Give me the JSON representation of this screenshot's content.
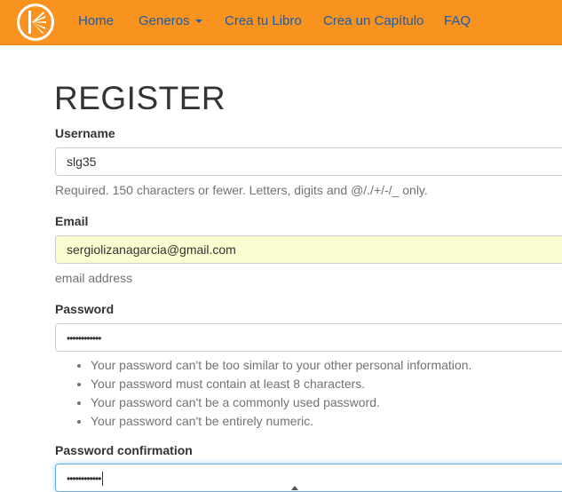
{
  "navbar": {
    "logo_icon": "book-logo-icon",
    "links": {
      "home": "Home",
      "generos": "Generos",
      "crea_libro": "Crea tu Libro",
      "crea_capitulo": "Crea un Capítulo",
      "faq": "FAQ"
    },
    "colors": {
      "background": "#f7931e",
      "link": "#1a5dab"
    }
  },
  "form": {
    "title": "REGISTER",
    "username": {
      "label": "Username",
      "value": "slg35",
      "help": "Required. 150 characters or fewer. Letters, digits and @/./+/-/_ only."
    },
    "email": {
      "label": "Email",
      "value": "sergiolizanagarcia@gmail.com",
      "help": "email address"
    },
    "password": {
      "label": "Password",
      "value": "••••••••••••",
      "rules": [
        "Your password can't be too similar to your other personal information.",
        "Your password must contain at least 8 characters.",
        "Your password can't be a commonly used password.",
        "Your password can't be entirely numeric."
      ]
    },
    "password_confirmation": {
      "label": "Password confirmation",
      "value": "••••••••••••"
    }
  }
}
